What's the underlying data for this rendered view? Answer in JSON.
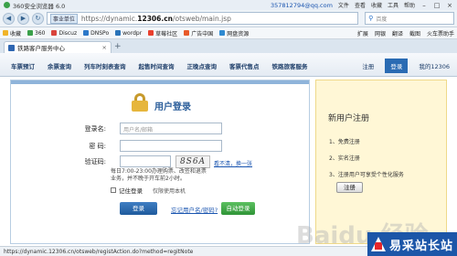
{
  "browser": {
    "title": "360安全浏览器 6.0",
    "account": "357812794@qq.com",
    "menu": [
      "文件",
      "查看",
      "收藏",
      "工具",
      "帮助"
    ],
    "nav": {
      "back": "◀",
      "forward": "▶",
      "refresh": "↻"
    },
    "address": {
      "site_badge": "事业单位",
      "url_prefix": "https://dynamic.",
      "url_domain": "12306.cn",
      "url_suffix": "/otsweb/main.jsp"
    },
    "search": {
      "placeholder": "百度",
      "icon": "search-icon"
    },
    "bookmarks_left": [
      {
        "label": "收藏",
        "color": "#f0b428"
      },
      {
        "label": "360",
        "color": "#3aa04a"
      },
      {
        "label": "Discuz",
        "color": "#d9443c"
      },
      {
        "label": "DNSPo",
        "color": "#2d78c9"
      },
      {
        "label": "wordpr",
        "color": "#2b74b9"
      },
      {
        "label": "草莓社区",
        "color": "#e9402e"
      },
      {
        "label": "广告中国",
        "color": "#e85a2a"
      },
      {
        "label": "网盘资源",
        "color": "#2f8ad1"
      }
    ],
    "bookmarks_right": [
      "扩展",
      "网银",
      "翻译",
      "截图",
      "火车票助手"
    ],
    "tab_title": "铁路客户服务中心",
    "tab_close": "×",
    "new_tab": "+",
    "status_text": "https://dynamic.12306.cn/otsweb/registAction.do?method=regitNote"
  },
  "site": {
    "nav_links": [
      "车票预订",
      "余票查询",
      "列车时刻表查询",
      "起售时间查询",
      "正晚点查询",
      "客票代售点",
      "铁路旅客服务"
    ],
    "register_link": "注册",
    "login_tab": "登录",
    "my_12306": "我的12306"
  },
  "login": {
    "title": "用户登录",
    "username_label": "登录名:",
    "username_placeholder": "用户名/邮箱",
    "password_label": "密  码:",
    "captcha_label": "验证码:",
    "captcha_text": "8S6A",
    "captcha_refresh": "看不清，换一张",
    "hint": "每日7:00-23:00办理购票、改签和退票业务，并不晚于开车前2小时。",
    "remember_label": "记住登录",
    "remember_note": "仅限使用本机",
    "login_button": "登录",
    "forgot_link": "忘记用户名/密码?",
    "auto_login_button": "自动登录"
  },
  "register": {
    "title": "新用户注册",
    "steps": [
      "1、免费注册",
      "2、实名注册",
      "3、注册用户可享受个性化服务"
    ],
    "button": "注册"
  },
  "watermark": "Baidu 经验",
  "corner_logo": "易采站长站"
}
